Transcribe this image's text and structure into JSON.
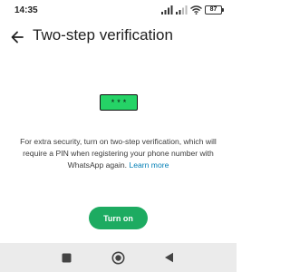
{
  "status_bar": {
    "time": "14:35",
    "battery": "87",
    "icons": [
      "cellular-signal-icon",
      "cellular-signal-icon",
      "wifi-icon",
      "battery-icon"
    ]
  },
  "app_bar": {
    "back_icon": "back-arrow-icon",
    "title": "Two-step verification"
  },
  "illustration": {
    "dots": [
      "*",
      "*",
      "*"
    ],
    "color": "#25d366"
  },
  "description": {
    "text": "For extra security, turn on two-step verification, which will require a PIN when registering your phone number with WhatsApp again. ",
    "link": "Learn more",
    "link_color": "#027eb5"
  },
  "actions": {
    "turn_on_label": "Turn on",
    "button_color": "#1dab61"
  },
  "nav_bar": {
    "buttons": [
      "recents-square-icon",
      "home-circle-icon",
      "back-triangle-icon"
    ]
  }
}
